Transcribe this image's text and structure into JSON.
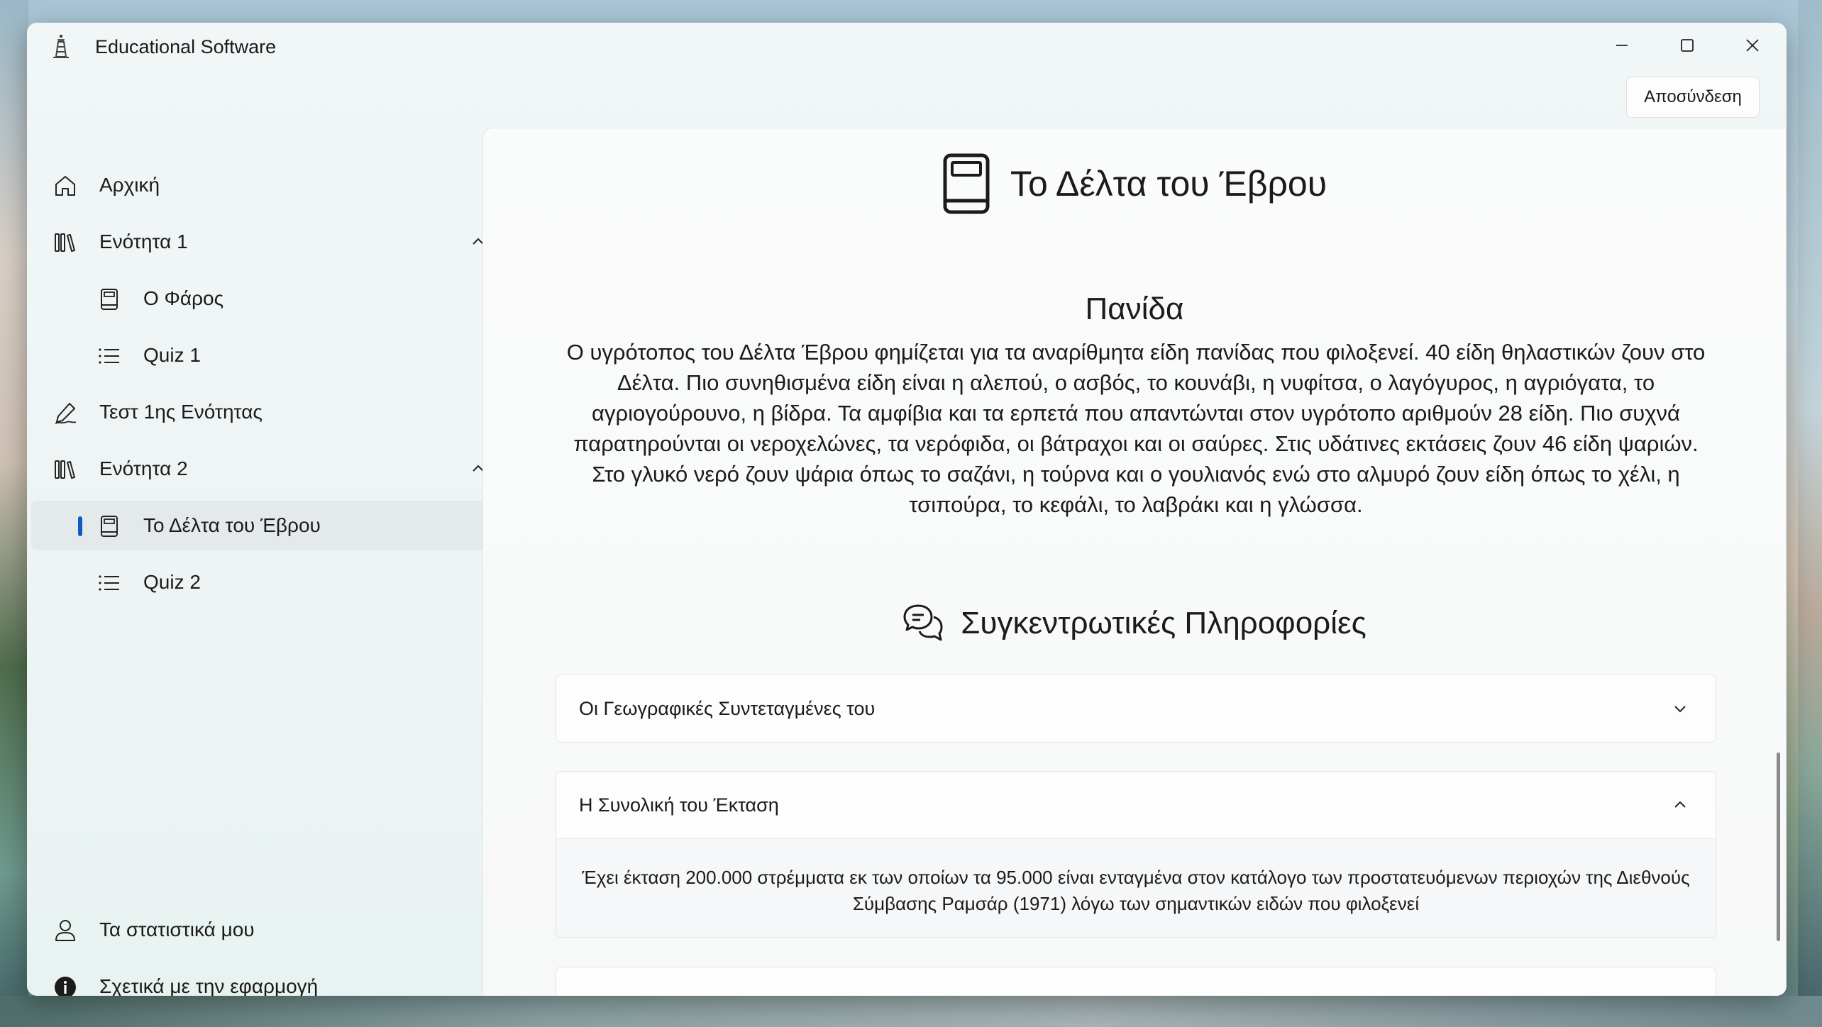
{
  "window": {
    "title": "Educational Software",
    "controls": [
      "minimize",
      "maximize",
      "close"
    ]
  },
  "header": {
    "logout_label": "Αποσύνδεση"
  },
  "sidebar": {
    "items": [
      {
        "label": "Αρχική",
        "icon": "home-icon"
      },
      {
        "label": "Ενότητα 1",
        "icon": "library-icon",
        "expanded": true
      },
      {
        "label": "Ο Φάρος",
        "icon": "book-icon"
      },
      {
        "label": "Quiz 1",
        "icon": "list-icon"
      },
      {
        "label": "Τεστ 1ης Ενότητας",
        "icon": "signature-icon"
      },
      {
        "label": "Ενότητα 2",
        "icon": "library-icon",
        "expanded": true
      },
      {
        "label": "Το Δέλτα του Έβρου",
        "icon": "book-icon",
        "selected": true
      },
      {
        "label": "Quiz 2",
        "icon": "list-icon"
      }
    ],
    "footer": [
      {
        "label": "Τα στατιστικά μου",
        "icon": "person-icon"
      },
      {
        "label": "Σχετικά με την εφαρμογή",
        "icon": "info-icon"
      }
    ]
  },
  "main": {
    "title": "Το Δέλτα του Έβρου",
    "section_title": "Πανίδα",
    "paragraph": "Ο υγρότοπος του Δέλτα Έβρου φημίζεται για τα αναρίθμητα είδη πανίδας που φιλοξενεί. 40 είδη θηλαστικών ζουν στο Δέλτα. Πιο συνηθισμένα είδη είναι η αλεπού, ο ασβός, το κουνάβι, η νυφίτσα, ο λαγόγυρος, η αγριόγατα, το αγριογούρουνο, η βίδρα. Τα αμφίβια και τα ερπετά που απαντώνται στον υγρότοπο αριθμούν 28 είδη. Πιο συχνά παρατηρούνται οι νεροχελώνες, τα νερόφιδα, οι βάτραχοι και οι σαύρες. Στις υδάτινες εκτάσεις ζουν 46 είδη ψαριών. Στο γλυκό νερό ζουν ψάρια όπως το σαζάνι, η τούρνα και ο γουλιανός ενώ στο αλμυρό ζουν είδη όπως το χέλι, η τσιπούρα, το κεφάλι, το λαβράκι και η γλώσσα.",
    "summary_title": "Συγκεντρωτικές Πληροφορίες",
    "expanders": [
      {
        "label": "Οι Γεωγραφικές Συντεταγμένες του",
        "expanded": false
      },
      {
        "label": "Η Συνολική του Έκταση",
        "expanded": true,
        "body": "Έχει έκταση 200.000 στρέμματα εκ των οποίων τα 95.000 είναι ενταγμένα στον κατάλογο των προστατευόμενων περιοχών της Διεθνούς Σύμβασης Ραμσάρ (1971) λόγω των σημαντικών ειδών που φιλοξενεί"
      }
    ]
  },
  "colors": {
    "accent": "#0a5cc2",
    "selected_bg": "#e4eaec",
    "text": "#1b1b1b"
  }
}
